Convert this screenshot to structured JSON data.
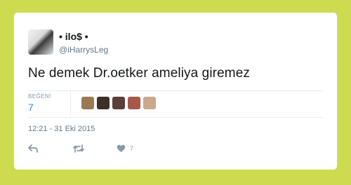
{
  "tweet": {
    "display_name": "• ilo$ •",
    "handle": "@iHarrysLeg",
    "text": "Ne demek Dr.oetker ameliya giremez",
    "timestamp": "12:21 - 31 Eki 2015"
  },
  "likes": {
    "label": "BEĞENİ",
    "count": "7",
    "avatar_colors": [
      "#9a7a55",
      "#3b3128",
      "#5a4038",
      "#a8584a",
      "#c9a98e"
    ]
  },
  "actions": {
    "reply_icon": "reply-icon",
    "retweet_icon": "retweet-icon",
    "like_icon": "heart-icon",
    "like_count": "7"
  },
  "colors": {
    "background": "#cddc4f",
    "accent": "#1b95e0",
    "muted": "#8899a6"
  }
}
